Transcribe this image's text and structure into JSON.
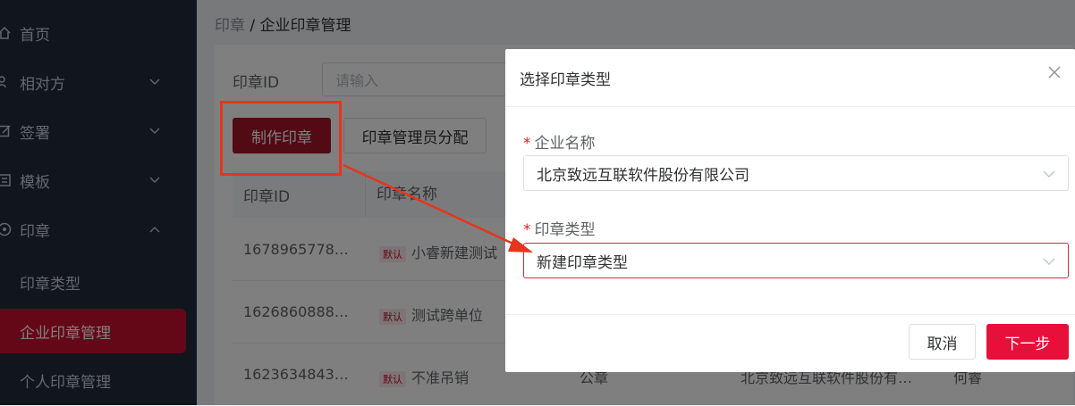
{
  "sidebar": {
    "items": [
      {
        "label": "首页",
        "icon": "home-icon"
      },
      {
        "label": "相对方",
        "icon": "users-icon",
        "expand": "down"
      },
      {
        "label": "签署",
        "icon": "edit-icon",
        "expand": "down"
      },
      {
        "label": "模板",
        "icon": "template-icon",
        "expand": "down"
      },
      {
        "label": "印章",
        "icon": "seal-icon",
        "expand": "up"
      }
    ],
    "sub_items": [
      {
        "label": "印章类型",
        "active": false
      },
      {
        "label": "企业印章管理",
        "active": true
      },
      {
        "label": "个人印章管理",
        "active": false
      }
    ]
  },
  "breadcrumb": {
    "parent": "印章",
    "separator": " / ",
    "current": "企业印章管理"
  },
  "filter": {
    "id_label": "印章ID",
    "id_placeholder": "请输入"
  },
  "toolbar": {
    "make_label": "制作印章",
    "assign_label": "印章管理员分配"
  },
  "table": {
    "headers": [
      "印章ID",
      "印章名称"
    ],
    "badge": "默认",
    "rows": [
      {
        "id": "1678965778…",
        "name": "小睿新建测试",
        "type": "",
        "company": "",
        "owner": ""
      },
      {
        "id": "1626860888…",
        "name": "测试跨单位",
        "type": "",
        "company": "",
        "owner": ""
      },
      {
        "id": "1623634843…",
        "name": "不准吊销",
        "type": "公章",
        "company": "北京致远互联软件股份有…",
        "owner": "何睿"
      }
    ]
  },
  "dialog": {
    "title": "选择印章类型",
    "company_label": "企业名称",
    "company_value": "北京致远互联软件股份有限公司",
    "type_label": "印章类型",
    "type_value": "新建印章类型",
    "cancel_label": "取消",
    "next_label": "下一步"
  },
  "colors": {
    "brand": "#c8102e",
    "annotation": "#e8341c",
    "sidebar_bg": "#222b3d"
  }
}
